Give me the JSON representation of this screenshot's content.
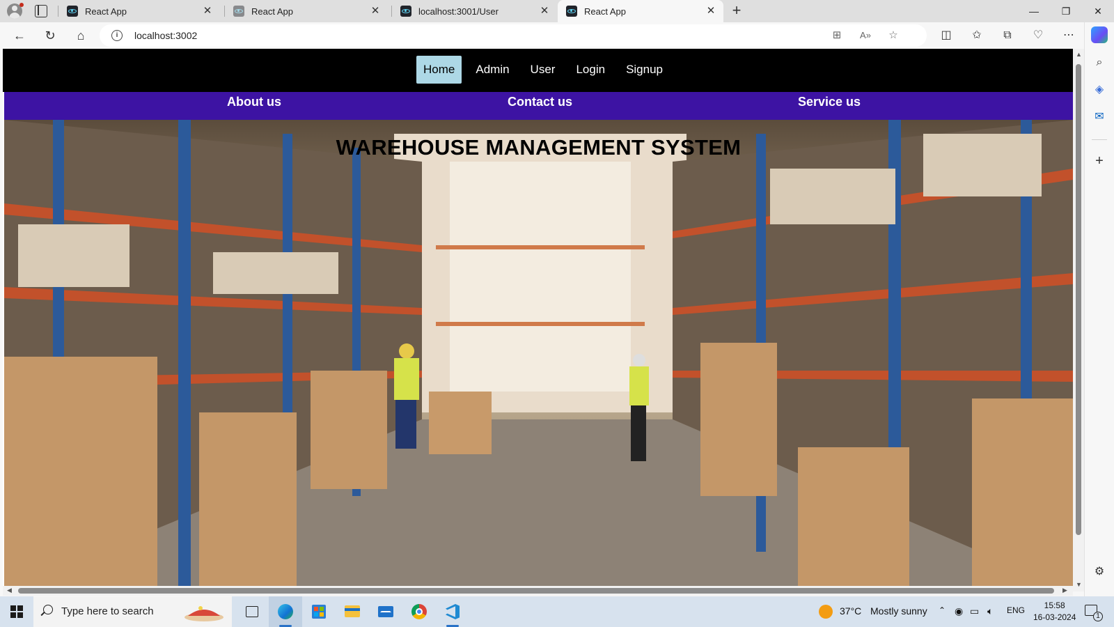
{
  "browser": {
    "tabs": [
      {
        "title": "React App",
        "active": false,
        "favicon": "react-icon"
      },
      {
        "title": "React App",
        "active": false,
        "favicon": "react-icon"
      },
      {
        "title": "localhost:3001/User",
        "active": false,
        "favicon": "react-icon"
      },
      {
        "title": "React App",
        "active": true,
        "favicon": "react-icon"
      }
    ],
    "url": "localhost:3002"
  },
  "page": {
    "nav": {
      "links": [
        {
          "label": "Home",
          "active": true
        },
        {
          "label": "Admin",
          "active": false
        },
        {
          "label": "User",
          "active": false
        },
        {
          "label": "Login",
          "active": false
        },
        {
          "label": "Signup",
          "active": false
        }
      ]
    },
    "subnav": {
      "links": [
        "About us",
        "Contact us",
        "Service us"
      ]
    },
    "hero": {
      "title": "WAREHOUSE MANAGEMENT SYSTEM"
    }
  },
  "taskbar": {
    "search_placeholder": "Type here to search",
    "weather": {
      "temp": "37°C",
      "condition": "Mostly sunny"
    },
    "language": "ENG",
    "time": "15:58",
    "date": "16-03-2024",
    "notification_count": "1"
  },
  "colors": {
    "navbar_bg": "#000000",
    "active_nav_bg": "#add8e6",
    "subnav_bg": "#3d13a3",
    "taskbar_bg": "#d7e2ee"
  }
}
